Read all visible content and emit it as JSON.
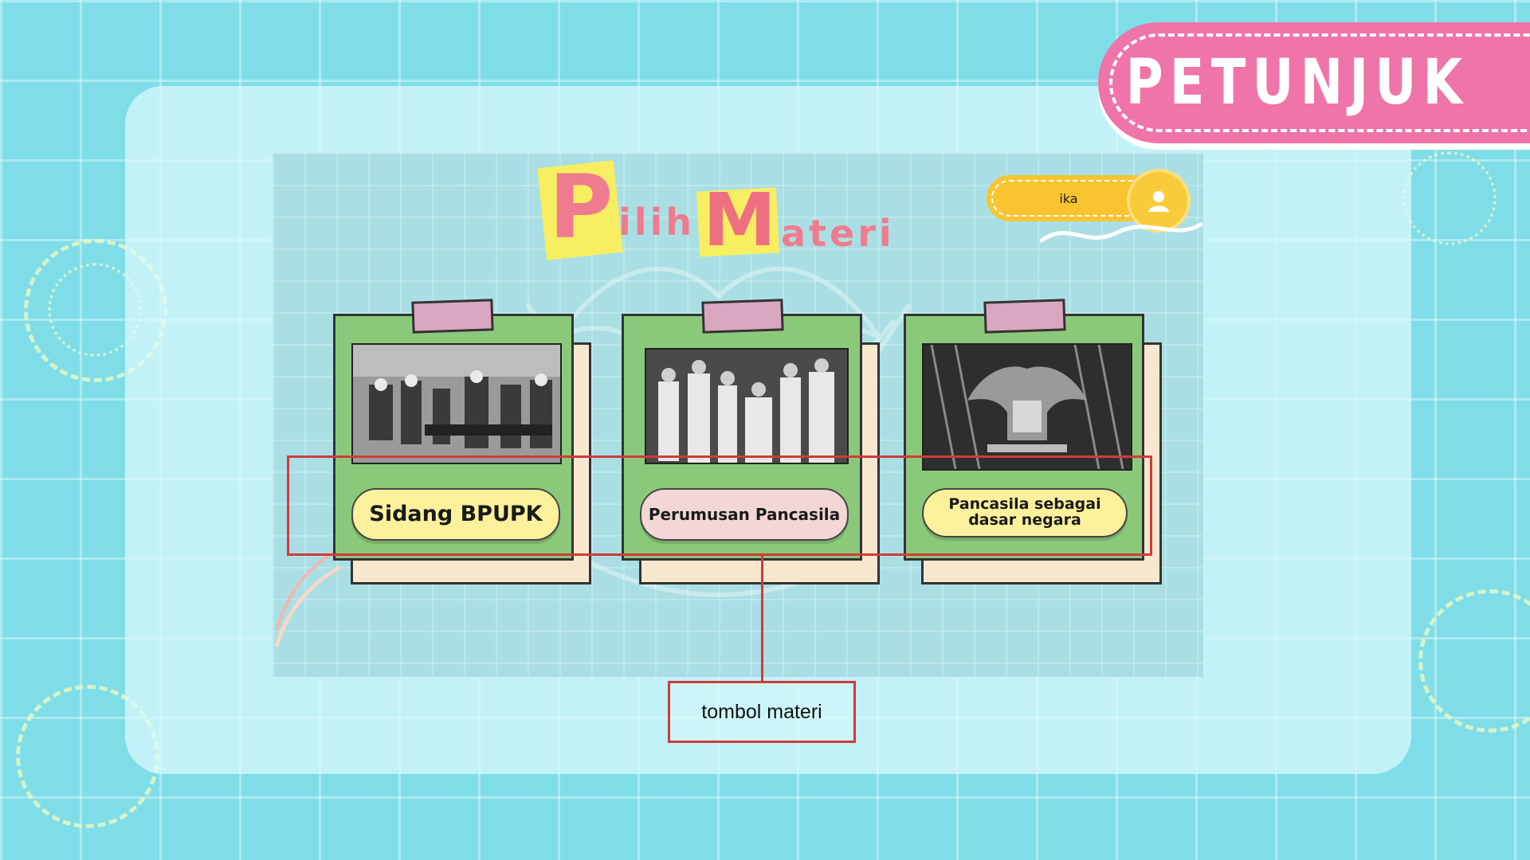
{
  "header": {
    "tag_label": "PETUNJUK"
  },
  "title": {
    "first_letter": "P",
    "first_rest": "ilih",
    "second_letter": "M",
    "second_rest": "ateri"
  },
  "user": {
    "name": "ika",
    "avatar_icon": "user-icon"
  },
  "cards": [
    {
      "label": "Sidang BPUPK",
      "button_color": "#fbf19c",
      "photo_desc_icon": "photo"
    },
    {
      "label": "Perumusan Pancasila",
      "button_color": "#f3d6d6",
      "photo_desc_icon": "photo"
    },
    {
      "label": "Pancasila sebagai dasar negara",
      "button_color": "#fbf19c",
      "photo_desc_icon": "photo"
    }
  ],
  "annotation": {
    "callout_label": "tombol materi",
    "color": "#d23a3a"
  },
  "colors": {
    "background": "#7fdde8",
    "accent_pink": "#ef74a8",
    "card_green": "#8bc97a",
    "user_pill": "#f8c531"
  }
}
